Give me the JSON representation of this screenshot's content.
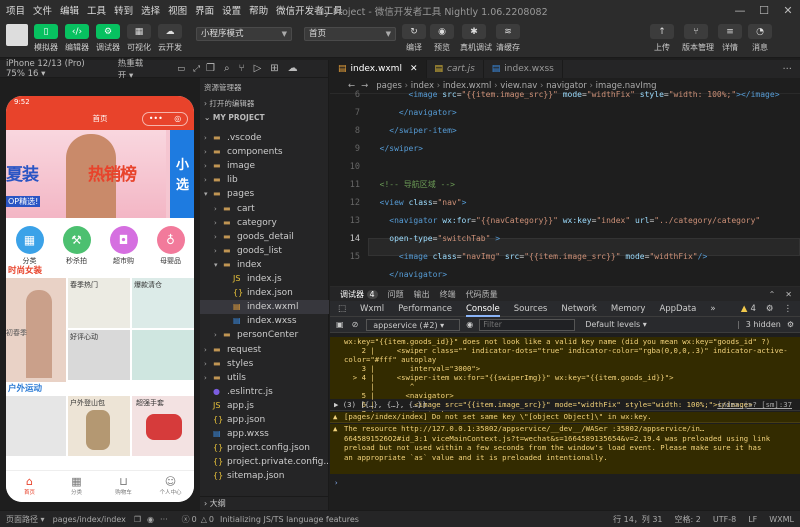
{
  "menu": [
    "项目",
    "文件",
    "编辑",
    "工具",
    "转到",
    "选择",
    "视图",
    "界面",
    "设置",
    "帮助",
    "微信开发者工具"
  ],
  "window_title": "My Project - 微信开发者工具 Nightly 1.06.2208082",
  "toolbar": {
    "left_buttons": [
      "模拟器",
      "编辑器",
      "调试器",
      "可视化",
      "云开发"
    ],
    "mode_select": "小程序模式",
    "page_select": "首页",
    "mid_buttons": [
      "编译",
      "预览",
      "真机调试",
      "清缓存"
    ],
    "right_buttons": [
      "上传",
      "版本管理",
      "详情",
      "消息"
    ]
  },
  "simulator": {
    "device": "iPhone 12/13 (Pro) 75% 16 ▾",
    "hotreload": "热重载 开 ▾",
    "time": "9:52",
    "nav_title": "首页",
    "banner_texts": [
      "夏装",
      "热销榜",
      "OP精选!",
      "小",
      "选"
    ],
    "categories": [
      {
        "label": "分类",
        "color": "#3ba2e8",
        "icon": "grid-icon"
      },
      {
        "label": "秒杀拍",
        "color": "#4cc070",
        "icon": "hammer-icon"
      },
      {
        "label": "超市购",
        "color": "#d56fe0",
        "icon": "bag-icon"
      },
      {
        "label": "母婴品",
        "color": "#f27a9b",
        "icon": "bottle-icon"
      }
    ],
    "section1": "时尚女装",
    "section1_tiles": [
      "春季热门",
      "爆款清仓",
      "初春季",
      "好评心动"
    ],
    "section2": "户外运动",
    "section2_tiles": [
      "户外登山包",
      "超强手套"
    ],
    "tabs": [
      "首页",
      "分类",
      "购物车",
      "个人中心"
    ]
  },
  "explorer": {
    "header": "资源管理器",
    "open_editors": "打开的编辑器",
    "project": "MY PROJECT",
    "items": [
      {
        "name": ".vscode",
        "type": "folder",
        "depth": 1,
        "open": false
      },
      {
        "name": "components",
        "type": "folder",
        "depth": 1,
        "open": false
      },
      {
        "name": "image",
        "type": "folder",
        "depth": 1,
        "open": false
      },
      {
        "name": "lib",
        "type": "folder",
        "depth": 1,
        "open": false
      },
      {
        "name": "pages",
        "type": "folder",
        "depth": 1,
        "open": true
      },
      {
        "name": "cart",
        "type": "folder",
        "depth": 2,
        "open": false
      },
      {
        "name": "category",
        "type": "folder",
        "depth": 2,
        "open": false
      },
      {
        "name": "goods_detail",
        "type": "folder",
        "depth": 2,
        "open": false
      },
      {
        "name": "goods_list",
        "type": "folder",
        "depth": 2,
        "open": false
      },
      {
        "name": "index",
        "type": "folder",
        "depth": 2,
        "open": true
      },
      {
        "name": "index.js",
        "type": "js",
        "depth": 3
      },
      {
        "name": "index.json",
        "type": "json",
        "depth": 3
      },
      {
        "name": "index.wxml",
        "type": "wxml",
        "depth": 3,
        "selected": true
      },
      {
        "name": "index.wxss",
        "type": "wxss",
        "depth": 3
      },
      {
        "name": "personCenter",
        "type": "folder",
        "depth": 2,
        "open": false
      },
      {
        "name": "request",
        "type": "folder",
        "depth": 1,
        "open": false
      },
      {
        "name": "styles",
        "type": "folder",
        "depth": 1,
        "open": false
      },
      {
        "name": "utils",
        "type": "folder",
        "depth": 1,
        "open": false
      },
      {
        "name": ".eslintrc.js",
        "type": "eslint",
        "depth": 1
      },
      {
        "name": "app.js",
        "type": "js",
        "depth": 1
      },
      {
        "name": "app.json",
        "type": "json",
        "depth": 1
      },
      {
        "name": "app.wxss",
        "type": "wxss",
        "depth": 1
      },
      {
        "name": "project.config.json",
        "type": "json",
        "depth": 1
      },
      {
        "name": "project.private.config...",
        "type": "json",
        "depth": 1
      },
      {
        "name": "sitemap.json",
        "type": "json",
        "depth": 1
      }
    ],
    "outline": "大纲"
  },
  "editor": {
    "tabs": [
      {
        "name": "index.wxml",
        "active": true
      },
      {
        "name": "cart.js",
        "active": false
      },
      {
        "name": "index.wxss",
        "active": false
      }
    ],
    "breadcrumb": [
      "pages",
      "index",
      "index.wxml",
      "view.nav",
      "navigator",
      "image.navImg"
    ],
    "line_numbers": [
      "6",
      "7",
      "8",
      "9",
      "10",
      "11",
      "12",
      "13",
      "14",
      "15"
    ],
    "current_line": "14"
  },
  "devtools": {
    "top_tabs": [
      "调试器",
      "4",
      "问题",
      "输出",
      "终端",
      "代码质量"
    ],
    "tabs": [
      "Wxml",
      "Performance",
      "Console",
      "Sources",
      "Network",
      "Memory",
      "AppData"
    ],
    "active_tab": "Console",
    "warn_count": "4",
    "context": "appservice (#2)",
    "filter_placeholder": "Filter",
    "levels": "Default levels ▾",
    "hidden": "3 hidden",
    "objects_line": "▶ (3) [{…}, {…}, {…}]",
    "log_link": "index.js? [sm]:37",
    "warn_line": "[pages/index/index] Do not set same key \\\"[object Object]\\\" in wx:key.",
    "preload_warning": "The resource http://127.0.0.1:35802/appservice/__dev__/WASer :35802/appservice/in…6645891526O2#id_3:1 viceMainContext.js?t=wechat&s=1664589135654&v=2.19.4 was preloaded using link preload but not used within a few seconds from the window's load event. Please make sure it has an appropriate `as` value and it is preloaded intentionally.",
    "prompt": "›"
  },
  "statusbar": {
    "path_label": "页面路径 ▾",
    "path": "pages/index/index",
    "errors": "0",
    "warnings": "0",
    "message": "Initializing JS/TS language features",
    "position": "行 14，列 31",
    "spaces": "空格: 2",
    "encoding": "UTF-8",
    "eol": "LF",
    "lang": "WXML"
  }
}
